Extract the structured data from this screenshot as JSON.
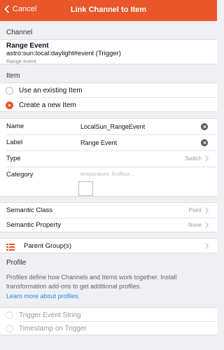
{
  "navbar": {
    "back_label": "Cancel",
    "title": "Link Channel to Item",
    "color": "#e8562a"
  },
  "channel": {
    "section_title": "Channel",
    "name": "Range Event",
    "uid": "astro:sun:local:daylight#event (Trigger)",
    "description": "Range event"
  },
  "item": {
    "section_title": "Item",
    "options": [
      {
        "label": "Use an existing Item",
        "selected": false
      },
      {
        "label": "Create a new Item",
        "selected": true
      }
    ]
  },
  "fields": {
    "name_label": "Name",
    "name_value": "LocalSun_RangeEvent",
    "label_label": "Label",
    "label_value": "Range Event",
    "type_label": "Type",
    "type_value": "Switch",
    "category_label": "Category",
    "category_placeholder": "temperature, firstfloor..."
  },
  "semantics": {
    "class_label": "Semantic Class",
    "class_value": "Point",
    "property_label": "Semantic Property",
    "property_value": "None"
  },
  "parent_groups": {
    "label": "Parent Group(s)"
  },
  "profile": {
    "section_title": "Profile",
    "description": "Profiles define how Channels and Items work together. Install transformation add-ons to get additional profiles.",
    "link": "Learn more about profiles.",
    "options": [
      {
        "label": "Trigger Event String",
        "enabled": false
      },
      {
        "label": "Timestamp on Trigger",
        "enabled": false
      }
    ]
  }
}
